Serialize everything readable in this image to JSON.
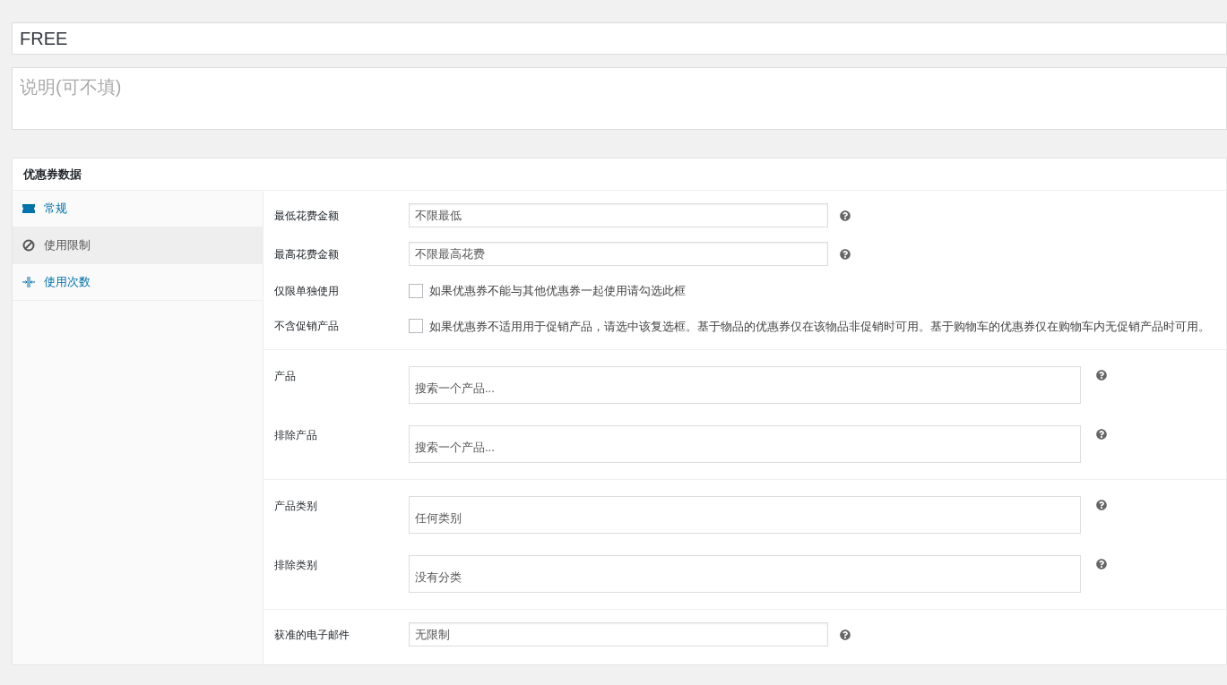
{
  "title_field": {
    "value": "FREE"
  },
  "description_field": {
    "placeholder": "说明(可不填)"
  },
  "panel": {
    "title": "优惠券数据",
    "tabs": [
      {
        "label": "常规",
        "selected": false
      },
      {
        "label": "使用限制",
        "selected": true
      },
      {
        "label": "使用次数",
        "selected": false
      }
    ],
    "sections": [
      {
        "rows": [
          {
            "kind": "text",
            "label": "最低花费金额",
            "placeholder": "不限最低"
          },
          {
            "kind": "text",
            "label": "最高花费金额",
            "placeholder": "不限最高花费"
          },
          {
            "kind": "checkbox",
            "label": "仅限单独使用",
            "checked": false,
            "description": "如果优惠券不能与其他优惠券一起使用请勾选此框"
          },
          {
            "kind": "checkbox",
            "label": "不含促销产品",
            "checked": false,
            "description": "如果优惠券不适用用于促销产品，请选中该复选框。基于物品的优惠券仅在该物品非促销时可用。基于购物车的优惠券仅在购物车内无促销产品时可用。"
          }
        ]
      },
      {
        "rows": [
          {
            "kind": "search",
            "label": "产品",
            "placeholder": "搜索一个产品..."
          },
          {
            "kind": "search",
            "label": "排除产品",
            "placeholder": "搜索一个产品..."
          }
        ]
      },
      {
        "rows": [
          {
            "kind": "search",
            "label": "产品类别",
            "placeholder": "任何类别"
          },
          {
            "kind": "search",
            "label": "排除类别",
            "placeholder": "没有分类"
          }
        ]
      },
      {
        "rows": [
          {
            "kind": "text",
            "label": "获准的电子邮件",
            "placeholder": "无限制"
          }
        ]
      }
    ]
  }
}
